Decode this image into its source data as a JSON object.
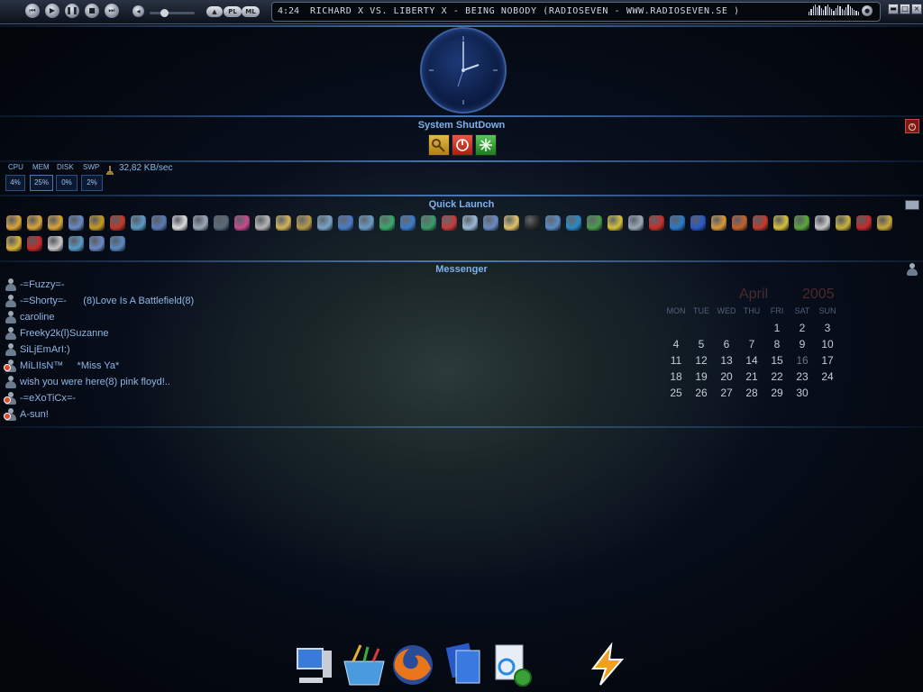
{
  "player": {
    "time": "4:24",
    "track": "RICHARD X VS. LIBERTY X - BEING NOBODY  (RADIOSEVEN - WWW.RADIOSEVEN.SE )",
    "buttons": [
      "prev",
      "play",
      "pause",
      "stop",
      "next"
    ],
    "pl_label": "PL",
    "ml_label": "ML",
    "eject_label": "▲",
    "winbtns": [
      "▬",
      "□",
      "×"
    ]
  },
  "shutdown": {
    "title": "System ShutDown",
    "buttons": [
      {
        "name": "lock-button",
        "color": "#c99a1c"
      },
      {
        "name": "power-button",
        "color": "#c4301e"
      },
      {
        "name": "restart-button",
        "color": "#3aa03a"
      }
    ]
  },
  "stats": {
    "labels": [
      "CPU",
      "MEM",
      "DISK",
      "SWP"
    ],
    "values": [
      "4%",
      "25%",
      "0%",
      "2%"
    ],
    "net": "32,82 KB/sec"
  },
  "quick_launch": {
    "title": "Quick Launch",
    "row1_colors": [
      "#d9a43a",
      "#d9a43a",
      "#d9a43a",
      "#6a88c4",
      "#c79a22",
      "#c43a2a",
      "#5a9ac4",
      "#5a7ab4",
      "#dcdcdc",
      "#9aa8b8",
      "#5a6a7a",
      "#c84a8a",
      "#b6b6b6",
      "#d4b45a",
      "#b49a4a",
      "#7aa4c8",
      "#4a7ac8",
      "#6a9ac4",
      "#3aa86a",
      "#3a7ac8",
      "#3a9a6a",
      "#c83a3a",
      "#9ab8d8",
      "#6a8ac4",
      "#e0c36a",
      "#2a2a2a",
      "#5a8ac4",
      "#2a8ac4",
      "#4a9a4a",
      "#d4c03a",
      "#9aa8b8",
      "#c4302a",
      "#2a7ac8",
      "#2a5ac8",
      "#d89a3a",
      "#c4602a",
      "#c43a2a",
      "#d8c03a",
      "#5aa83a",
      "#c8c8c8",
      "#c8b43a",
      "#c42a2a",
      "#c8a83a"
    ],
    "row2_colors": [
      "#d8b43a",
      "#c42a2a",
      "#c8c8c8",
      "#5a9ac4",
      "#6a8ac4",
      "#5a8ac4"
    ]
  },
  "messenger": {
    "title": "Messenger",
    "contacts": [
      {
        "name": "-=Fuzzy=-",
        "away": false
      },
      {
        "name": "-=Shorty=-      (8)Love Is A Battlefield(8)",
        "away": false
      },
      {
        "name": "caroline",
        "away": false
      },
      {
        "name": "Freeky2k(l)Suzanne",
        "away": false
      },
      {
        "name": "SiLjEmArI:)",
        "away": false
      },
      {
        "name": "MiLIIsN™     *Miss Ya*",
        "away": true
      },
      {
        "name": "wish you were here(8) pink floyd!..",
        "away": false
      },
      {
        "name": "-=eXoTiCx=-",
        "away": true
      },
      {
        "name": "A-sun!",
        "away": true
      }
    ]
  },
  "calendar": {
    "month": "April",
    "year": "2005",
    "weekdays": [
      "MON",
      "TUE",
      "WED",
      "THU",
      "FRI",
      "SAT",
      "SUN"
    ],
    "weeks": [
      [
        "",
        "",
        "",
        "",
        "1",
        "2",
        "3"
      ],
      [
        "4",
        "5",
        "6",
        "7",
        "8",
        "9",
        "10"
      ],
      [
        "11",
        "12",
        "13",
        "14",
        "15",
        "16",
        "17"
      ],
      [
        "18",
        "19",
        "20",
        "21",
        "22",
        "23",
        "24"
      ],
      [
        "25",
        "26",
        "27",
        "28",
        "29",
        "30",
        ""
      ]
    ],
    "today": "16"
  },
  "dock": [
    {
      "name": "my-computer-icon"
    },
    {
      "name": "graphics-tools-icon"
    },
    {
      "name": "firefox-icon"
    },
    {
      "name": "documents-icon"
    },
    {
      "name": "settings-icon"
    },
    {
      "name": "winamp-icon"
    }
  ]
}
